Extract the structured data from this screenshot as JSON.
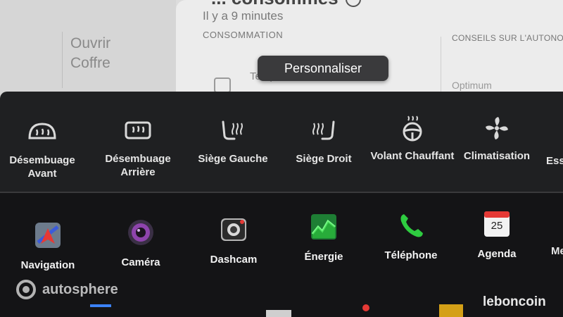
{
  "header": {
    "title_clipped": "... consommés",
    "time_ago": "Il y a 9 minutes",
    "consumption_label": "CONSOMMATION",
    "advice_label": "CONSEILS SUR L'AUTONOM",
    "temps_label": "Temps ...",
    "optimum_label": "Optimum"
  },
  "trunk": {
    "line1": "Ouvrir",
    "line2": "Coffre"
  },
  "customize_button": "Personnaliser",
  "controls": [
    {
      "line1": "Désembuage",
      "line2": "Avant",
      "icon": "front-defrost-icon"
    },
    {
      "line1": "Désembuage",
      "line2": "Arrière",
      "icon": "rear-defrost-icon"
    },
    {
      "line1": "Siège Gauche",
      "line2": "",
      "icon": "seat-heat-left-icon"
    },
    {
      "line1": "Siège Droit",
      "line2": "",
      "icon": "seat-heat-right-icon"
    },
    {
      "line1": "Volant Chauffant",
      "line2": "",
      "icon": "heated-steering-icon"
    },
    {
      "line1": "Climatisation",
      "line2": "",
      "icon": "fan-icon"
    },
    {
      "line1": "Essu",
      "line2": "",
      "icon": ""
    }
  ],
  "apps": [
    {
      "label": "Navigation",
      "icon": "navigation-icon"
    },
    {
      "label": "Caméra",
      "icon": "camera-icon"
    },
    {
      "label": "Dashcam",
      "icon": "dashcam-icon"
    },
    {
      "label": "Énergie",
      "icon": "energy-icon"
    },
    {
      "label": "Téléphone",
      "icon": "phone-icon"
    },
    {
      "label": "Agenda",
      "icon": "calendar-icon",
      "date": "25"
    },
    {
      "label": "Me",
      "icon": ""
    }
  ],
  "watermarks": {
    "autosphere": "autosphere",
    "leboncoin": "leboncoin"
  },
  "colors": {
    "tray": "#1f2022",
    "accent_green": "#2ecc40",
    "camera_purple": "#8e44ad",
    "calendar_red": "#e53935"
  }
}
